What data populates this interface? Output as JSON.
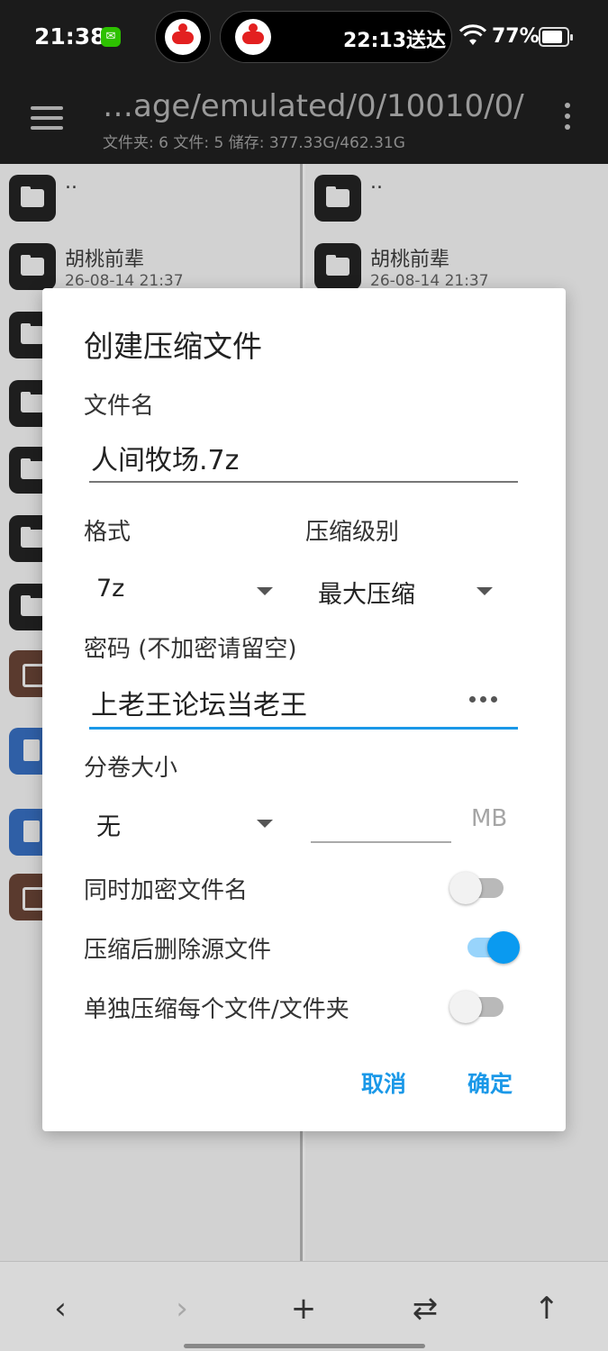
{
  "status_bar": {
    "time": "21:38",
    "live_activity_text": "22:13送达",
    "battery_percent": "77%",
    "battery_level": 0.77,
    "icons": [
      "wechat-icon",
      "scooter-icon",
      "wifi-icon",
      "battery-icon"
    ]
  },
  "toolbar": {
    "path": "…age/emulated/0/10010/0/",
    "meta": "文件夹: 6  文件: 5  储存: 377.33G/462.31G"
  },
  "left_pane": {
    "items": [
      {
        "name": "..",
        "date": "",
        "type": "folder-up"
      },
      {
        "name": "胡桃前辈",
        "date": "26-08-14 21:37",
        "type": "folder"
      },
      {
        "name": "",
        "date": "",
        "type": "folder"
      },
      {
        "name": "",
        "date": "",
        "type": "folder"
      },
      {
        "name": "",
        "date": "",
        "type": "folder"
      },
      {
        "name": "",
        "date": "",
        "type": "folder"
      },
      {
        "name": "",
        "date": "",
        "type": "folder"
      },
      {
        "name": "",
        "date": "",
        "type": "archive"
      },
      {
        "name": "",
        "date": "",
        "type": "doc"
      },
      {
        "name": "",
        "date": "",
        "type": "doc"
      },
      {
        "name": "",
        "date": "",
        "type": "archive"
      }
    ]
  },
  "right_pane": {
    "items": [
      {
        "name": "..",
        "date": "",
        "type": "folder-up"
      },
      {
        "name": "胡桃前辈",
        "date": "26-08-14 21:37",
        "type": "folder"
      }
    ]
  },
  "dialog": {
    "title": "创建压缩文件",
    "filename_label": "文件名",
    "filename_value": "人间牧场.7z",
    "format_label": "格式",
    "format_value": "7z",
    "level_label": "压缩级别",
    "level_value": "最大压缩",
    "password_label": "密码 (不加密请留空)",
    "password_value": "上老王论坛当老王",
    "volume_label": "分卷大小",
    "volume_value": "无",
    "volume_size_value": "",
    "volume_unit": "MB",
    "encrypt_names_label": "同时加密文件名",
    "encrypt_names_on": false,
    "delete_source_label": "压缩后删除源文件",
    "delete_source_on": true,
    "separate_label": "单独压缩每个文件/文件夹",
    "separate_on": false,
    "cancel_label": "取消",
    "ok_label": "确定"
  },
  "bottom_nav": {
    "back_icon": "‹",
    "forward_icon": "›",
    "add_icon": "+",
    "swap_icon": "⇄",
    "up_icon": "↑"
  },
  "colors": {
    "accent": "#1a98e8",
    "switch_on": "#0a9af0",
    "bar_dark": "#1b1b1b"
  }
}
